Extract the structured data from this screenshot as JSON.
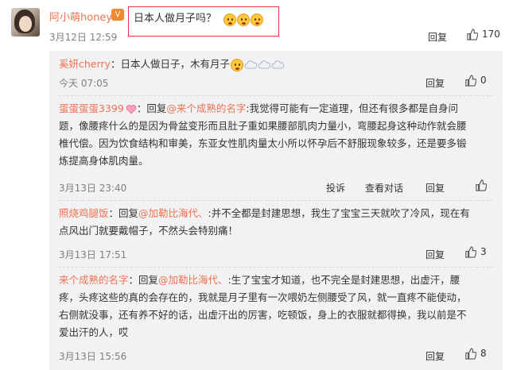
{
  "main_comment": {
    "username": "阿小萌honey",
    "badge": "V",
    "text": "日本人做月子吗？",
    "timestamp": "3月12日 12:59",
    "reply_label": "回复",
    "like_count": "170",
    "highlight_color": "#e0393e"
  },
  "replies": [
    {
      "username": "奚妍cherry",
      "sep": "：",
      "text": "日本人做日子，木有月子",
      "timestamp": "今天 07:05",
      "reply_label": "回复",
      "like_count": "0"
    },
    {
      "username": "蛋蛋蛋蛋3399",
      "prefix": "：回复",
      "mention": "@来个成熟的名字",
      "text_line1": ":我觉得可能有一定道理，但还有很多都是自身问",
      "text_line2": "题，像腰疼什么的是因为骨盆变形而且肚子重如果腰部肌肉力量小，弯腰起身这种动作就会腰",
      "text_line3": "椎代偿。因为饮食结构和审美，东亚女性肌肉量太小所以怀孕后不舒服现象较多，还是要多锻",
      "text_line4": "炼提高身体肌肉量。",
      "timestamp": "3月13日 23:40",
      "report_label": "投诉",
      "dialog_label": "查看对话",
      "reply_label": "回复"
    },
    {
      "username": "照烧鸡腿饭",
      "prefix": "：回复",
      "mention": "@加勒比海代、",
      "text_line1": ":并不全都是封建思想，我生了宝宝三天就吹了冷风，现在有",
      "text_line2": "点风出门就要戴帽子，不然头会特别痛！",
      "timestamp": "3月13日 17:51",
      "reply_label": "回复",
      "like_count": "3"
    },
    {
      "username": "来个成熟的名字",
      "prefix": "：回复",
      "mention": "@加勒比海代、",
      "text_line1": ":生了宝宝才知道，也不完全是封建思想，出虚汗，腰",
      "text_line2": "疼，头疼这些的真的会存在的，我就是月子里有一次喂奶左侧腰受了风，就一直疼不能使动，",
      "text_line3": "右侧就没事，还有养不好的话，出虚汗出的厉害，吃顿饭，身上的衣服就都得换，我以前是不",
      "text_line4": "爱出汗的人，哎",
      "timestamp": "3月13日 15:56",
      "reply_label": "回复",
      "like_count": "8"
    }
  ],
  "icons": {
    "thumb": "thumbs-up-icon",
    "vip": "vip-badge-icon",
    "emoji": "laughing-face-icon",
    "heart": "heart-badge-icon",
    "cloud": "cloud-icon"
  }
}
